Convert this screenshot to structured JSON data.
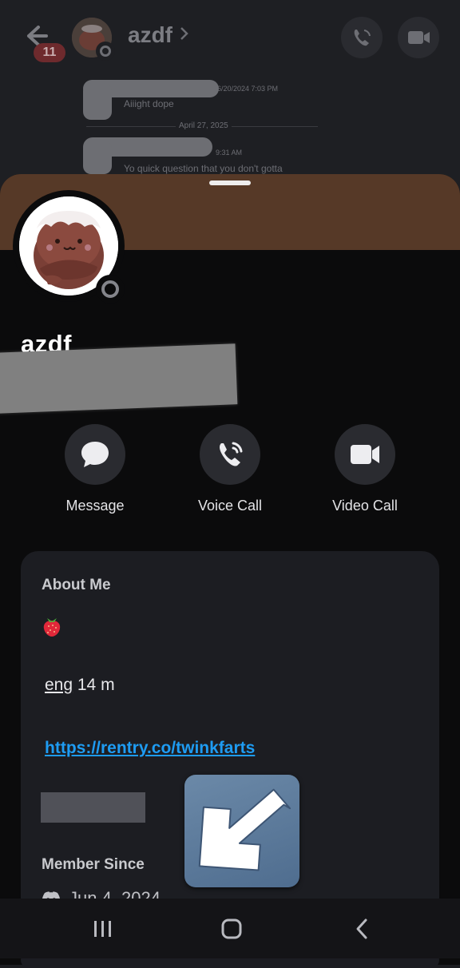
{
  "chat": {
    "contact_name": "azdf",
    "unread_count": "11",
    "messages": [
      {
        "timestamp": "6/20/2024 7:03 PM",
        "text": "Aiiight dope"
      },
      {
        "timestamp": "9:31 AM",
        "text": "Yo quick question that you don't gotta"
      }
    ],
    "date_divider": "April 27, 2025"
  },
  "profile": {
    "display_name": "azdf",
    "status": "offline",
    "banner_color": "#563927"
  },
  "actions": [
    {
      "label": "Message",
      "icon": "chat-bubble-icon"
    },
    {
      "label": "Voice Call",
      "icon": "phone-call-icon"
    },
    {
      "label": "Video Call",
      "icon": "video-camera-icon"
    }
  ],
  "about": {
    "title": "About Me",
    "emoji": "strawberry",
    "lang_underlined": "eng",
    "lang_rest": " 14 m",
    "link": "https://rentry.co/twinkfarts"
  },
  "member_since": {
    "title": "Member Since",
    "date": "Jun 4, 2024"
  },
  "colors": {
    "link": "#1e9cf3",
    "sheet_bg": "#0b0b0c",
    "card_bg": "#1c1d22",
    "arrow_overlay": "#5b7a9b"
  }
}
